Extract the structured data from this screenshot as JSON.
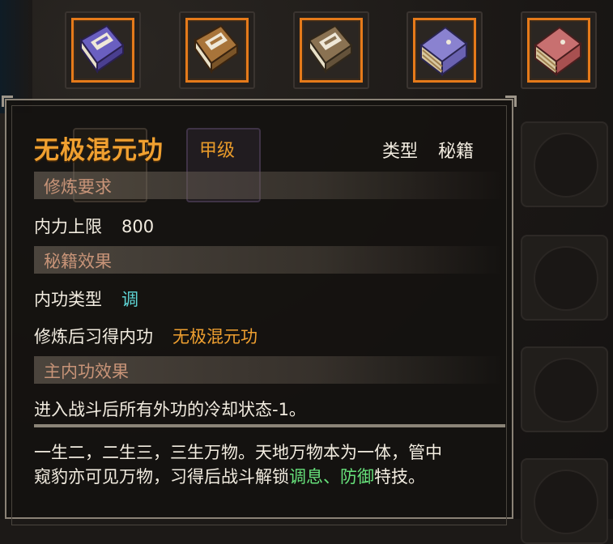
{
  "top_items": [
    {
      "icon": "purple-book-icon"
    },
    {
      "icon": "brown-book-icon"
    },
    {
      "icon": "tan-book-icon"
    },
    {
      "icon": "purple-stack-icon"
    },
    {
      "icon": "red-stack-icon"
    }
  ],
  "tooltip": {
    "title": "无极混元功",
    "grade": "甲级",
    "type_label": "类型",
    "type_value": "秘籍",
    "sections": {
      "requirement": "修炼要求",
      "effect": "秘籍效果",
      "main_effect": "主内功效果"
    },
    "requirement_row": {
      "label": "内力上限",
      "value": "800"
    },
    "effect_rows": {
      "type_label": "内功类型",
      "type_value": "调",
      "learn_label": "修炼后习得内功",
      "learn_value": "无极混元功"
    },
    "main_effect_text": "进入战斗后所有外功的冷却状态-1。",
    "description": {
      "line1": "一生二，二生三，三生万物。天地万物本为一体，管中",
      "line2_prefix": "窥豹亦可见万物，习得后战斗解锁",
      "skill1": "调息",
      "sep": "、",
      "skill2": "防御",
      "line2_suffix": "特技。"
    }
  },
  "colors": {
    "title": "#f0a030",
    "selected_border": "#e57a1a",
    "cyan": "#5fd6d6",
    "green": "#66e07a"
  }
}
